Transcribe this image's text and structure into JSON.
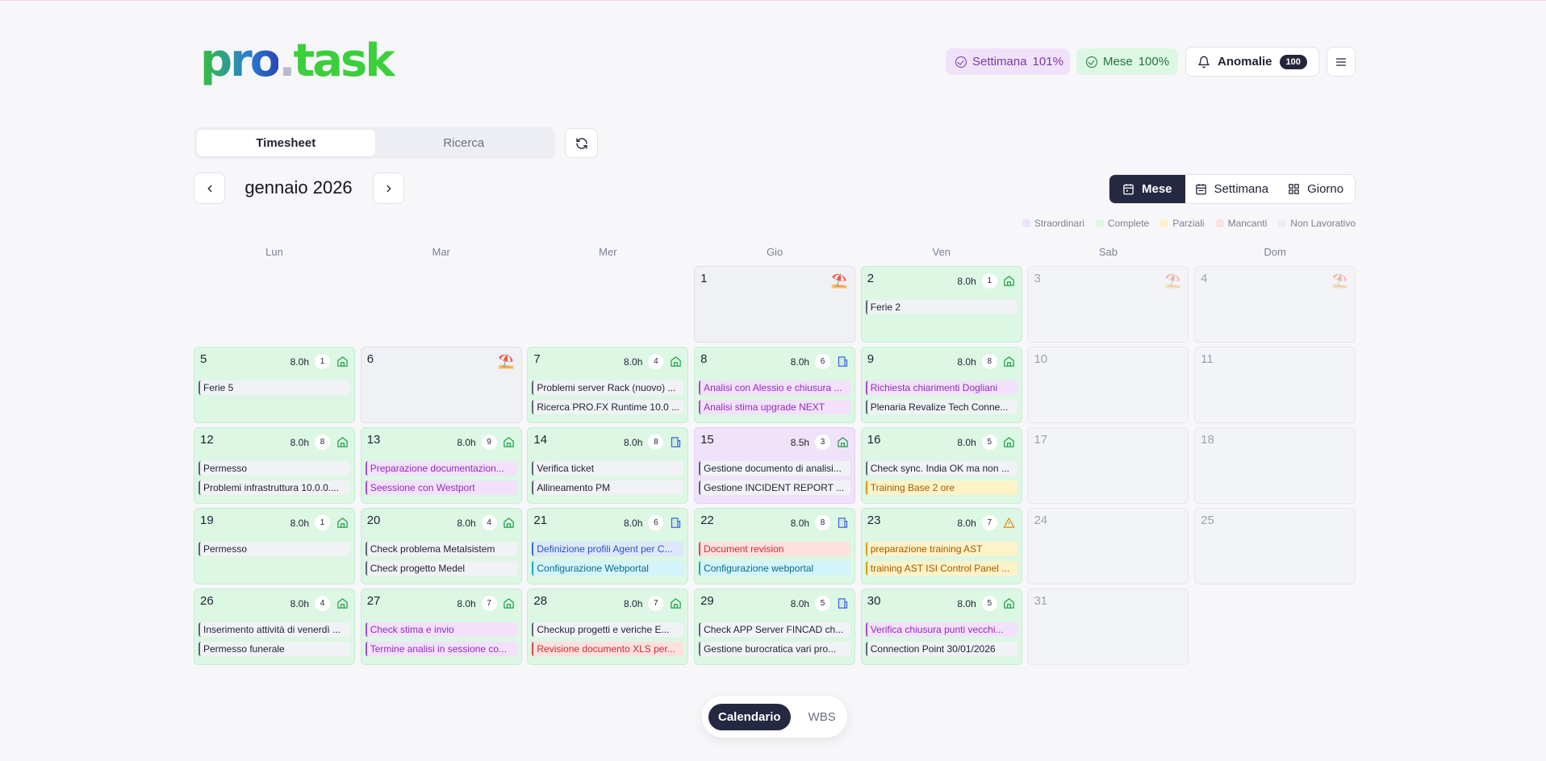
{
  "logo": {
    "part1": "pro",
    "dot": ".",
    "part2": "task"
  },
  "header": {
    "week_badge": {
      "label": "Settimana",
      "value": "101%"
    },
    "month_badge": {
      "label": "Mese",
      "value": "100%"
    },
    "anomalies": {
      "label": "Anomalie",
      "count": "100"
    }
  },
  "tabs": [
    {
      "label": "Timesheet",
      "active": true
    },
    {
      "label": "Ricerca",
      "active": false
    }
  ],
  "month_title": "gennaio 2026",
  "views": [
    {
      "label": "Mese",
      "active": true
    },
    {
      "label": "Settimana",
      "active": false
    },
    {
      "label": "Giorno",
      "active": false
    }
  ],
  "legend": [
    {
      "label": "Straordinari",
      "color": "#ece3fb"
    },
    {
      "label": "Complete",
      "color": "#dcf7e3"
    },
    {
      "label": "Parziali",
      "color": "#fdf3c8"
    },
    {
      "label": "Mancanti",
      "color": "#fde0e0"
    },
    {
      "label": "Non Lavorativo",
      "color": "#eceef3"
    }
  ],
  "weekdays": [
    "Lun",
    "Mar",
    "Mer",
    "Gio",
    "Ven",
    "Sab",
    "Dom"
  ],
  "days": [
    {
      "day": "",
      "type": "empty"
    },
    {
      "day": "",
      "type": "empty"
    },
    {
      "day": "",
      "type": "empty"
    },
    {
      "day": "1",
      "type": "holiday",
      "umbrella": true
    },
    {
      "day": "2",
      "type": "work",
      "hours": "8.0h",
      "count": "1",
      "icon": "home",
      "events": [
        {
          "text": "Ferie 2",
          "color": "grey"
        }
      ]
    },
    {
      "day": "3",
      "type": "weekend",
      "umbrella": true
    },
    {
      "day": "4",
      "type": "weekend",
      "umbrella": true
    },
    {
      "day": "5",
      "type": "work",
      "hours": "8.0h",
      "count": "1",
      "icon": "home",
      "events": [
        {
          "text": "Ferie 5",
          "color": "grey"
        }
      ]
    },
    {
      "day": "6",
      "type": "holiday",
      "umbrella": true
    },
    {
      "day": "7",
      "type": "work",
      "hours": "8.0h",
      "count": "4",
      "icon": "home",
      "events": [
        {
          "text": "Problemi server Rack (nuovo) ...",
          "color": "grey"
        },
        {
          "text": "Ricerca PRO.FX Runtime 10.0 ...",
          "color": "grey"
        }
      ]
    },
    {
      "day": "8",
      "type": "work",
      "hours": "8.0h",
      "count": "6",
      "icon": "office",
      "events": [
        {
          "text": "Analisi con Alessio e chiusura ...",
          "color": "purple"
        },
        {
          "text": "Analisi stima upgrade NEXT",
          "color": "purple"
        }
      ]
    },
    {
      "day": "9",
      "type": "work",
      "hours": "8.0h",
      "count": "8",
      "icon": "home",
      "events": [
        {
          "text": "Richiesta chiarimenti Dogliani",
          "color": "purple"
        },
        {
          "text": "Plenaria Revalize Tech Conne...",
          "color": "grey"
        }
      ]
    },
    {
      "day": "10",
      "type": "weekend"
    },
    {
      "day": "11",
      "type": "weekend"
    },
    {
      "day": "12",
      "type": "work",
      "hours": "8.0h",
      "count": "8",
      "icon": "home",
      "events": [
        {
          "text": "Permesso",
          "color": "grey"
        },
        {
          "text": "Problemi infrastruttura 10.0.0....",
          "color": "grey"
        }
      ]
    },
    {
      "day": "13",
      "type": "work",
      "hours": "8.0h",
      "count": "9",
      "icon": "home",
      "events": [
        {
          "text": "Preparazione documentazion...",
          "color": "purple"
        },
        {
          "text": "Seessione con Westport",
          "color": "purple"
        }
      ]
    },
    {
      "day": "14",
      "type": "work",
      "hours": "8.0h",
      "count": "8",
      "icon": "office",
      "events": [
        {
          "text": "Verifica ticket",
          "color": "grey"
        },
        {
          "text": "Allineamento PM",
          "color": "grey"
        }
      ]
    },
    {
      "day": "15",
      "type": "partial-purple",
      "hours": "8.5h",
      "count": "3",
      "icon": "home",
      "events": [
        {
          "text": "Gestione documento di analisi...",
          "color": "grey"
        },
        {
          "text": "Gestione INCIDENT REPORT ...",
          "color": "grey"
        }
      ]
    },
    {
      "day": "16",
      "type": "work",
      "hours": "8.0h",
      "count": "5",
      "icon": "home",
      "events": [
        {
          "text": "Check sync. India OK ma non ...",
          "color": "grey"
        },
        {
          "text": "Training Base 2 ore",
          "color": "yellow"
        }
      ]
    },
    {
      "day": "17",
      "type": "weekend"
    },
    {
      "day": "18",
      "type": "weekend"
    },
    {
      "day": "19",
      "type": "work",
      "hours": "8.0h",
      "count": "1",
      "icon": "home",
      "events": [
        {
          "text": "Permesso",
          "color": "grey"
        }
      ]
    },
    {
      "day": "20",
      "type": "work",
      "hours": "8.0h",
      "count": "4",
      "icon": "home",
      "events": [
        {
          "text": "Check problema Metalsistem",
          "color": "grey"
        },
        {
          "text": "Check progetto Medel",
          "color": "grey"
        }
      ]
    },
    {
      "day": "21",
      "type": "work",
      "hours": "8.0h",
      "count": "6",
      "icon": "office",
      "events": [
        {
          "text": "Definizione profili Agent per C...",
          "color": "blue"
        },
        {
          "text": "Configurazione Webportal",
          "color": "cyan"
        }
      ]
    },
    {
      "day": "22",
      "type": "work",
      "hours": "8.0h",
      "count": "8",
      "icon": "office",
      "events": [
        {
          "text": "Document revision",
          "color": "red"
        },
        {
          "text": "Configurazione webportal",
          "color": "cyan"
        }
      ]
    },
    {
      "day": "23",
      "type": "work",
      "hours": "8.0h",
      "count": "7",
      "icon": "warning",
      "events": [
        {
          "text": "preparazione training AST",
          "color": "yellow"
        },
        {
          "text": "training AST ISI Control Panel ...",
          "color": "yellow"
        }
      ]
    },
    {
      "day": "24",
      "type": "weekend"
    },
    {
      "day": "25",
      "type": "weekend"
    },
    {
      "day": "26",
      "type": "work",
      "hours": "8.0h",
      "count": "4",
      "icon": "home",
      "events": [
        {
          "text": "Inserimento attività di venerdì ...",
          "color": "grey"
        },
        {
          "text": "Permesso funerale",
          "color": "grey"
        }
      ]
    },
    {
      "day": "27",
      "type": "work",
      "hours": "8.0h",
      "count": "7",
      "icon": "home",
      "events": [
        {
          "text": "Check stima e invio",
          "color": "purple"
        },
        {
          "text": "Termine analisi in sessione co...",
          "color": "purple"
        }
      ]
    },
    {
      "day": "28",
      "type": "work",
      "hours": "8.0h",
      "count": "7",
      "icon": "home",
      "events": [
        {
          "text": "Checkup progetti e veriche E...",
          "color": "grey"
        },
        {
          "text": "Revisione documento XLS per...",
          "color": "red"
        }
      ]
    },
    {
      "day": "29",
      "type": "work",
      "hours": "8.0h",
      "count": "5",
      "icon": "office",
      "events": [
        {
          "text": "Check APP Server FINCAD ch...",
          "color": "grey"
        },
        {
          "text": "Gestione burocratica vari pro...",
          "color": "grey"
        }
      ]
    },
    {
      "day": "30",
      "type": "work",
      "hours": "8.0h",
      "count": "5",
      "icon": "home",
      "events": [
        {
          "text": "Verifica chiusura punti vecchi...",
          "color": "purple"
        },
        {
          "text": "Connection Point 30/01/2026",
          "color": "grey"
        }
      ]
    },
    {
      "day": "31",
      "type": "weekend"
    },
    {
      "day": "",
      "type": "empty"
    }
  ],
  "bottom_toggle": [
    {
      "label": "Calendario",
      "active": true
    },
    {
      "label": "WBS",
      "active": false
    }
  ]
}
